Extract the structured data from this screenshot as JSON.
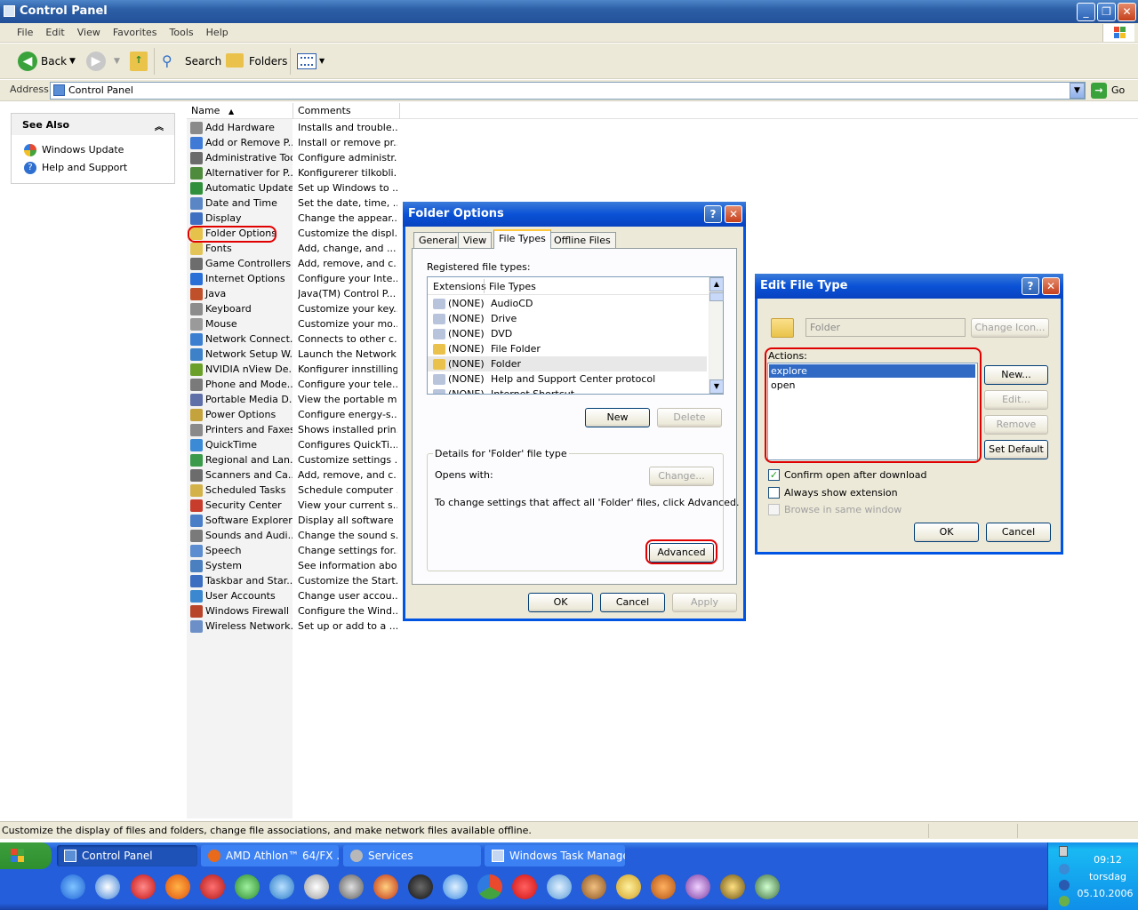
{
  "window": {
    "title": "Control Panel"
  },
  "menu": [
    "File",
    "Edit",
    "View",
    "Favorites",
    "Tools",
    "Help"
  ],
  "toolbar": {
    "back": "Back",
    "search": "Search",
    "folders": "Folders"
  },
  "address": {
    "label": "Address",
    "value": "Control Panel",
    "go": "Go"
  },
  "see_also": {
    "title": "See Also",
    "items": [
      "Windows Update",
      "Help and Support"
    ]
  },
  "list": {
    "col_name": "Name",
    "col_comments": "Comments",
    "rows": [
      {
        "name": "Add Hardware",
        "comment": "Installs and trouble...",
        "color": "#8a8a8a"
      },
      {
        "name": "Add or Remove P...",
        "comment": "Install or remove pr...",
        "color": "#3f7bd6"
      },
      {
        "name": "Administrative Tools",
        "comment": "Configure administr...",
        "color": "#6b6b6b"
      },
      {
        "name": "Alternativer for P...",
        "comment": "Konfigurerer tilkobli...",
        "color": "#4f8b3d"
      },
      {
        "name": "Automatic Updates",
        "comment": "Set up Windows to ...",
        "color": "#2f8f3a"
      },
      {
        "name": "Date and Time",
        "comment": "Set the date, time, ...",
        "color": "#5a86c6"
      },
      {
        "name": "Display",
        "comment": "Change the appear...",
        "color": "#3e6fc1"
      },
      {
        "name": "Folder Options",
        "comment": "Customize the displ...",
        "color": "#e6c24a"
      },
      {
        "name": "Fonts",
        "comment": "Add, change, and ...",
        "color": "#e3c458"
      },
      {
        "name": "Game Controllers",
        "comment": "Add, remove, and c...",
        "color": "#6d6d6d"
      },
      {
        "name": "Internet Options",
        "comment": "Configure your Inte...",
        "color": "#2a6fd6"
      },
      {
        "name": "Java",
        "comment": "Java(TM) Control P...",
        "color": "#c0502a"
      },
      {
        "name": "Keyboard",
        "comment": "Customize your key...",
        "color": "#8c8c8c"
      },
      {
        "name": "Mouse",
        "comment": "Customize your mo...",
        "color": "#9a9a9a"
      },
      {
        "name": "Network Connect...",
        "comment": "Connects to other c...",
        "color": "#3c7fd0"
      },
      {
        "name": "Network Setup W...",
        "comment": "Launch the Network...",
        "color": "#3d82c9"
      },
      {
        "name": "NVIDIA nView De...",
        "comment": "Konfigurer innstilling...",
        "color": "#6aa02a"
      },
      {
        "name": "Phone and Mode...",
        "comment": "Configure your tele...",
        "color": "#7a7a7a"
      },
      {
        "name": "Portable Media D...",
        "comment": "View the portable m...",
        "color": "#5f6fa8"
      },
      {
        "name": "Power Options",
        "comment": "Configure energy-s...",
        "color": "#c4a33c"
      },
      {
        "name": "Printers and Faxes",
        "comment": "Shows installed prin...",
        "color": "#8a8a8a"
      },
      {
        "name": "QuickTime",
        "comment": "Configures QuickTi...",
        "color": "#3a8ad6"
      },
      {
        "name": "Regional and Lan...",
        "comment": "Customize settings ...",
        "color": "#3b9a4a"
      },
      {
        "name": "Scanners and Ca...",
        "comment": "Add, remove, and c...",
        "color": "#6c6c6c"
      },
      {
        "name": "Scheduled Tasks",
        "comment": "Schedule computer ...",
        "color": "#d4b24a"
      },
      {
        "name": "Security Center",
        "comment": "View your current s...",
        "color": "#c83c2c"
      },
      {
        "name": "Software Explorers",
        "comment": "Display all software ...",
        "color": "#4a7fc8"
      },
      {
        "name": "Sounds and Audi...",
        "comment": "Change the sound s...",
        "color": "#7a7a7a"
      },
      {
        "name": "Speech",
        "comment": "Change settings for...",
        "color": "#5b8dd0"
      },
      {
        "name": "System",
        "comment": "See information abo...",
        "color": "#4a7fc0"
      },
      {
        "name": "Taskbar and Star...",
        "comment": "Customize the Start...",
        "color": "#3b6dc1"
      },
      {
        "name": "User Accounts",
        "comment": "Change user accou...",
        "color": "#3c88d0"
      },
      {
        "name": "Windows Firewall",
        "comment": "Configure the Wind...",
        "color": "#b8452a"
      },
      {
        "name": "Wireless Network...",
        "comment": "Set up or add to a ...",
        "color": "#6b8fc6"
      }
    ]
  },
  "folder_options": {
    "title": "Folder Options",
    "tabs": [
      "General",
      "View",
      "File Types",
      "Offline Files"
    ],
    "registered_label": "Registered file types:",
    "col_ext": "Extensions",
    "col_types": "File Types",
    "types": [
      {
        "ext": "(NONE)",
        "name": "AudioCD"
      },
      {
        "ext": "(NONE)",
        "name": "Drive"
      },
      {
        "ext": "(NONE)",
        "name": "DVD"
      },
      {
        "ext": "(NONE)",
        "name": "File Folder"
      },
      {
        "ext": "(NONE)",
        "name": "Folder"
      },
      {
        "ext": "(NONE)",
        "name": "Help and Support Center protocol"
      },
      {
        "ext": "(NONE)",
        "name": "Internet Shortcut"
      }
    ],
    "new": "New",
    "delete": "Delete",
    "details_label": "Details for 'Folder' file type",
    "opens_with": "Opens with:",
    "change": "Change...",
    "advanced_text": "To change settings that affect all 'Folder' files, click Advanced.",
    "advanced": "Advanced",
    "ok": "OK",
    "cancel": "Cancel",
    "apply": "Apply"
  },
  "edit_file_type": {
    "title": "Edit File Type",
    "name_value": "Folder",
    "change_icon": "Change Icon...",
    "actions_label": "Actions:",
    "actions": [
      "explore",
      "open"
    ],
    "new": "New...",
    "edit": "Edit...",
    "remove": "Remove",
    "set_default": "Set Default",
    "confirm_open": "Confirm open after download",
    "always_show": "Always show extension",
    "browse_same": "Browse in same window",
    "ok": "OK",
    "cancel": "Cancel"
  },
  "status": {
    "text": "Customize the display of files and folders, change file associations, and make network files available offline."
  },
  "taskbar": {
    "tasks": [
      "Control Panel",
      "AMD Athlon™ 64/FX ...",
      "Services",
      "Windows Task Manager"
    ],
    "time": "09:12",
    "day": "torsdag",
    "date": "05.10.2006"
  }
}
